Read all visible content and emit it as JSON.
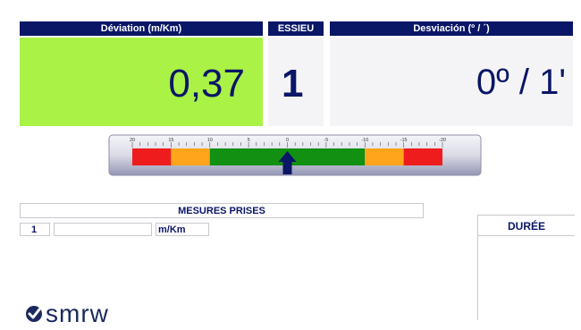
{
  "deviation": {
    "header": "Déviation (m/Km)",
    "value": "0,37",
    "bg_color": "#aaf245"
  },
  "axle": {
    "header": "ESSIEU",
    "value": "1"
  },
  "angle": {
    "header": "Desviación (º / ´)",
    "value": "0º / 1'"
  },
  "gauge": {
    "tick_labels": [
      "20",
      "15",
      "10",
      "5",
      "0",
      "-5",
      "-10",
      "-15",
      "-20"
    ],
    "pointer_value": 0,
    "zones": [
      {
        "from": 20,
        "to": 15,
        "color": "#ee1c1c"
      },
      {
        "from": 15,
        "to": 10,
        "color": "#ffa51c"
      },
      {
        "from": 10,
        "to": -10,
        "color": "#119011"
      },
      {
        "from": -10,
        "to": -15,
        "color": "#ffa51c"
      },
      {
        "from": -15,
        "to": -20,
        "color": "#ee1c1c"
      }
    ]
  },
  "measures": {
    "title": "MESURES PRISES",
    "rows": [
      {
        "index": "1",
        "value": "",
        "unit": "m/Km"
      }
    ]
  },
  "duration": {
    "title": "DURÉE"
  },
  "logo": {
    "text": "smrw"
  },
  "colors": {
    "header_bg": "#0a1666",
    "panel_bg": "#f4f4f6"
  }
}
